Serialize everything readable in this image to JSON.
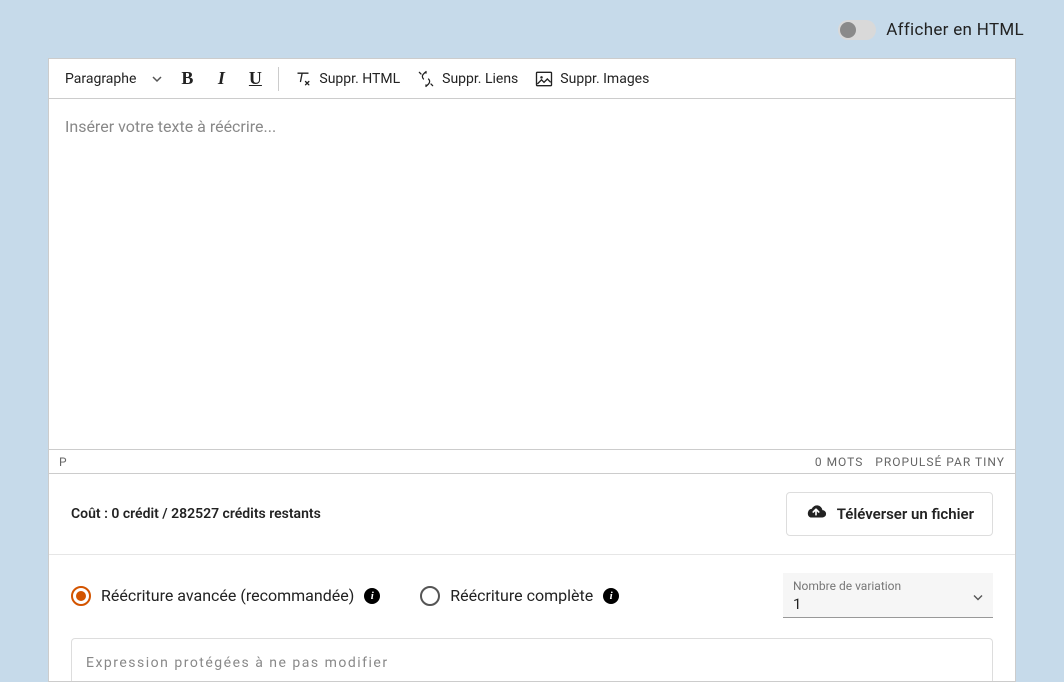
{
  "toggle": {
    "label": "Afficher en HTML"
  },
  "toolbar": {
    "format": "Paragraphe",
    "suppr_html": "Suppr. HTML",
    "suppr_liens": "Suppr. Liens",
    "suppr_images": "Suppr. Images"
  },
  "editor": {
    "placeholder": "Insérer votre texte à réécrire..."
  },
  "status": {
    "path": "P",
    "words": "0 MOTS",
    "powered": "PROPULSÉ PAR TINY"
  },
  "cost": {
    "text": "Coût : 0 crédit / 282527 crédits restants"
  },
  "upload": {
    "label": "Téléverser un fichier"
  },
  "radios": {
    "advanced": "Réécriture avancée (recommandée)",
    "complete": "Réécriture complète"
  },
  "variation": {
    "label": "Nombre de variation",
    "value": "1"
  },
  "protected": {
    "placeholder": "Expression protégées à ne pas modifier"
  }
}
